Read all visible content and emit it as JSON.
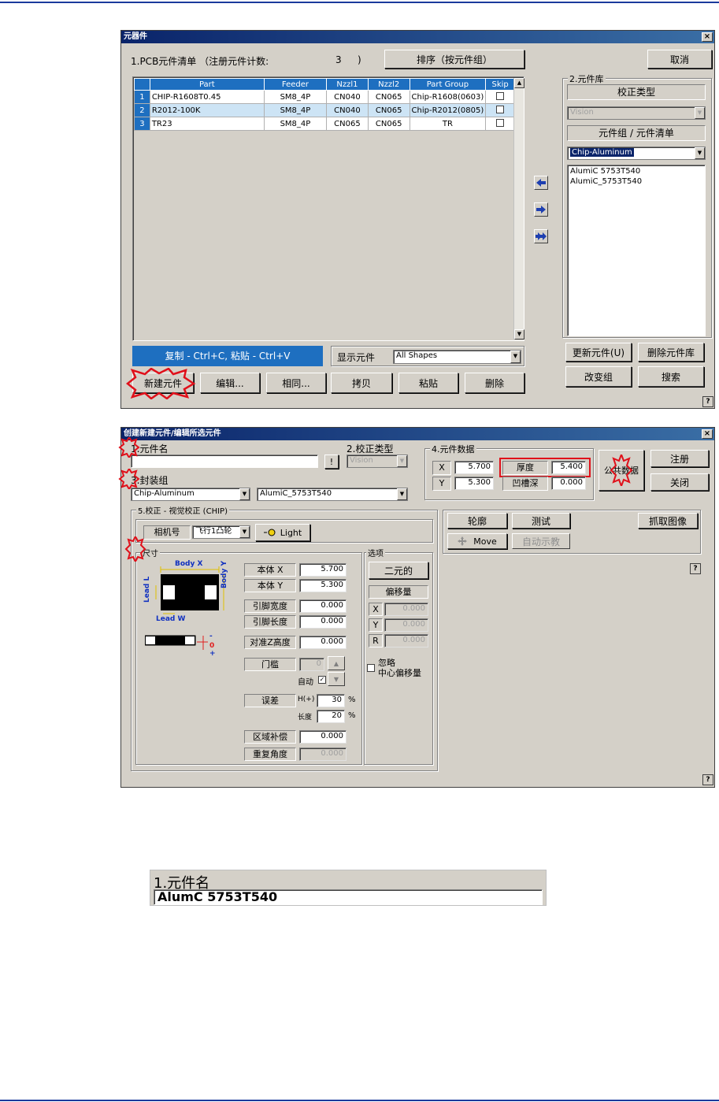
{
  "dialog1": {
    "title": "元器件",
    "pcb_list_label": "1.PCB元件清单 （注册元件计数:",
    "count": "3",
    "count_close": ")",
    "sort_button": "排序（按元件组）",
    "cancel_button": "取消",
    "table": {
      "columns": [
        "",
        "Part",
        "Feeder",
        "Nzzl1",
        "Nzzl2",
        "Part Group",
        "Skip"
      ],
      "rows": [
        {
          "num": "1",
          "part": "CHIP-R1608T0.45",
          "feeder": "SM8_4P",
          "nzzl1": "CN040",
          "nzzl2": "CN065",
          "group": "Chip-R1608(0603)"
        },
        {
          "num": "2",
          "part": "R2012-100K",
          "feeder": "SM8_4P",
          "nzzl1": "CN040",
          "nzzl2": "CN065",
          "group": "Chip-R2012(0805)"
        },
        {
          "num": "3",
          "part": "TR23",
          "feeder": "SM8_4P",
          "nzzl1": "CN065",
          "nzzl2": "CN065",
          "group": "TR"
        }
      ]
    },
    "copy_hint": "复制 - Ctrl+C, 粘贴 - Ctrl+V",
    "show_parts_label": "显示元件",
    "show_parts_value": "All Shapes",
    "buttons": {
      "new": "新建元件",
      "edit": "编辑...",
      "same": "相同...",
      "copy": "拷贝",
      "paste": "粘贴",
      "delete": "删除"
    },
    "library": {
      "group_title": "2.元件库",
      "calib_type_label": "校正类型",
      "calib_type_value": "Vision",
      "group_list_label": "元件组 / 元件清单",
      "group_value": "Chip-Aluminum",
      "items": [
        "AlumiC 5753T540",
        "AlumiC_5753T540"
      ],
      "update_button": "更新元件(U)",
      "delete_button": "删除元件库",
      "change_group_button": "改变组",
      "search_button": "搜索"
    },
    "help": "?"
  },
  "dialog2": {
    "title": "创建新建元件/编辑所选元件",
    "name_label": "1.元件名",
    "bang_button": "!",
    "calib_type_label": "2.校正类型",
    "calib_type_value": "Vision",
    "group_label": "3.封装组",
    "group_value": "Chip-Aluminum",
    "part_value": "AlumiC_5753T540",
    "data_group_title": "4.元件数据",
    "x_label": "X",
    "x_value": "5.700",
    "y_label": "Y",
    "y_value": "5.300",
    "thickness_label": "厚度",
    "thickness_value": "5.400",
    "recess_label": "凹槽深",
    "recess_value": "0.000",
    "public_button": "公共数据",
    "register_button": "注册",
    "close_button": "关闭",
    "calib_group_title": "5.校正 - 视觉校正 (CHIP)",
    "camera_label": "相机号",
    "camera_value": "飞行1凸轮",
    "light_button": "Light",
    "size_group_title": "尺寸",
    "diagram": {
      "body_x": "Body X",
      "body_y": "Body Y",
      "lead_l": "Lead L",
      "lead_w": "Lead W",
      "minus": "-",
      "zero": "0",
      "plus": "+"
    },
    "fields": {
      "body_x_label": "本体 X",
      "body_x_value": "5.700",
      "body_y_label": "本体 Y",
      "body_y_value": "5.300",
      "lead_w_label": "引脚宽度",
      "lead_w_value": "0.000",
      "lead_l_label": "引脚长度",
      "lead_l_value": "0.000",
      "align_z_label": "对准Z高度",
      "align_z_value": "0.000",
      "threshold_label": "门槛",
      "threshold_value": "0",
      "auto_label": "自动",
      "tolerance_label": "误差",
      "h_label": "H(+)",
      "h_value": "30",
      "h_unit": "%",
      "len_label": "长度",
      "len_value": "20",
      "len_unit": "%",
      "area_comp_label": "区域补偿",
      "area_comp_value": "0.000",
      "repeat_angle_label": "重复角度",
      "repeat_angle_value": "0.000"
    },
    "options": {
      "group_title": "选项",
      "binary_button": "二元的",
      "offset_label": "偏移量",
      "x": "X",
      "y": "Y",
      "r": "R",
      "x_value": "0.000",
      "y_value": "0.000",
      "r_value": "0.000",
      "ignore_line1": "忽略",
      "ignore_line2": "中心偏移量"
    },
    "top_buttons": {
      "outline": "轮廓",
      "test": "测试",
      "grab": "抓取图像",
      "move": "Move",
      "auto_teach": "自动示教"
    },
    "help": "?"
  },
  "zoom": {
    "label": "1.元件名",
    "value": "AlumC 5753T540"
  }
}
